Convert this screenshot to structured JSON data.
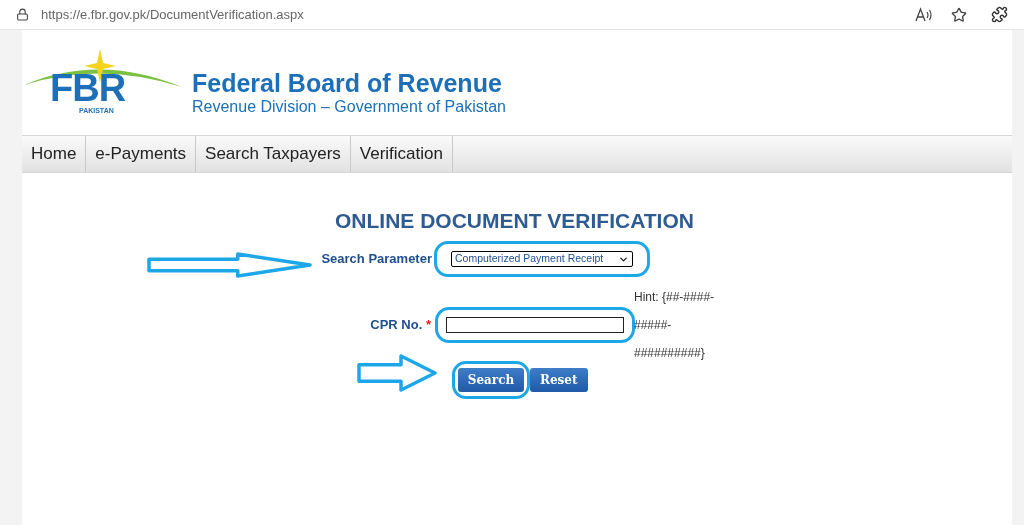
{
  "browser": {
    "url_host": "https://e.fbr.gov.pk",
    "url_path": "/DocumentVerification.aspx"
  },
  "header": {
    "logo_letters": "FBR",
    "logo_country": "PAKISTAN",
    "title": "Federal Board of Revenue",
    "subtitle": "Revenue Division – Government of Pakistan"
  },
  "nav": {
    "items": [
      "Home",
      "e-Payments",
      "Search Taxpayers",
      "Verification"
    ]
  },
  "form": {
    "title": "ONLINE DOCUMENT VERIFICATION",
    "search_parameter": {
      "label": "Search Parameter",
      "value": "Computerized Payment Receipt",
      "highlighted": true
    },
    "cpr": {
      "label": "CPR No.",
      "required_mark": "*",
      "hint": "Hint: {##-####-#####-##########}",
      "highlighted": true
    },
    "buttons": [
      {
        "label": "Search",
        "highlighted": true
      },
      {
        "label": "Reset",
        "highlighted": false
      }
    ]
  }
}
